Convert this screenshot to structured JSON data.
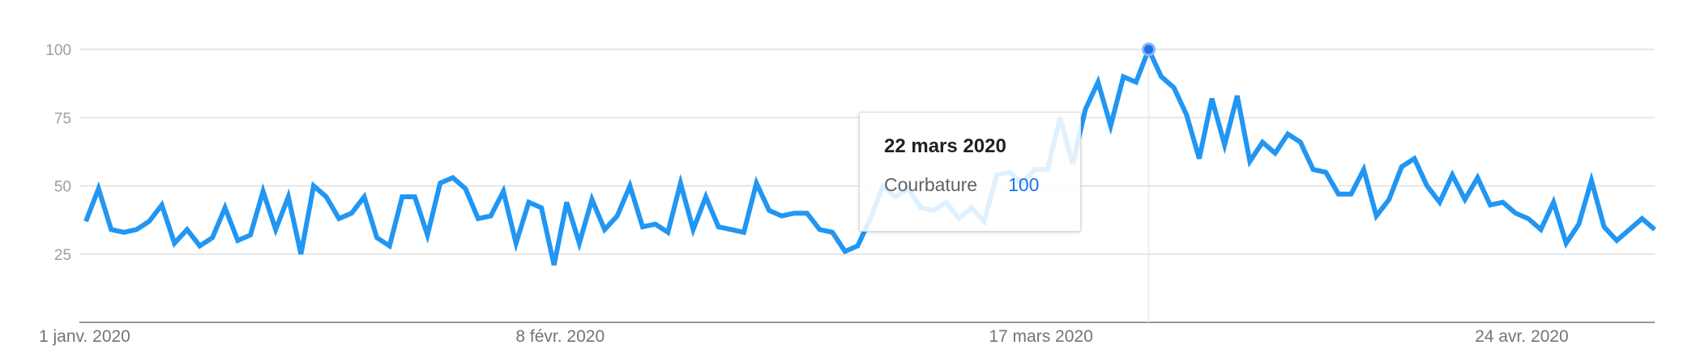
{
  "chart_data": {
    "type": "line",
    "y_ticks": [
      "100",
      "75",
      "50",
      "25"
    ],
    "ylim": [
      0,
      100
    ],
    "grid": true,
    "x_tick_labels": [
      "1 janv. 2020",
      "8 févr. 2020",
      "17 mars 2020",
      "24 avr. 2020"
    ],
    "x_start": "2020-01-01",
    "x_end": "2020-05-05",
    "series": [
      {
        "name": "Courbature",
        "color": "#2196f3",
        "values": [
          37,
          49,
          34,
          33,
          34,
          37,
          43,
          29,
          34,
          28,
          31,
          42,
          30,
          32,
          48,
          34,
          46,
          25,
          50,
          46,
          38,
          40,
          46,
          31,
          28,
          46,
          46,
          32,
          51,
          53,
          49,
          38,
          39,
          48,
          29,
          44,
          42,
          21,
          44,
          29,
          45,
          34,
          39,
          50,
          35,
          36,
          33,
          51,
          34,
          46,
          35,
          34,
          33,
          51,
          41,
          39,
          40,
          40,
          34,
          33,
          26,
          28,
          38,
          50,
          46,
          49,
          42,
          41,
          44,
          38,
          42,
          37,
          54,
          55,
          51,
          56,
          56,
          75,
          58,
          78,
          88,
          72,
          90,
          88,
          100,
          90,
          86,
          76,
          60,
          82,
          65,
          83,
          59,
          66,
          62,
          69,
          66,
          56,
          55,
          47,
          47,
          56,
          39,
          45,
          57,
          60,
          50,
          44,
          54,
          45,
          53,
          43,
          44,
          40,
          38,
          34,
          44,
          29,
          36,
          52,
          35,
          30,
          34,
          38,
          34
        ]
      }
    ],
    "highlight": {
      "date": "22 mars 2020",
      "value": 100
    }
  },
  "tooltip": {
    "date": "22 mars 2020",
    "term": "Courbature",
    "value": "100",
    "value_color": "#1a73e8"
  },
  "colors": {
    "grid": "#e0e0e0",
    "axis": "#70757a",
    "line": "#2196f3"
  }
}
